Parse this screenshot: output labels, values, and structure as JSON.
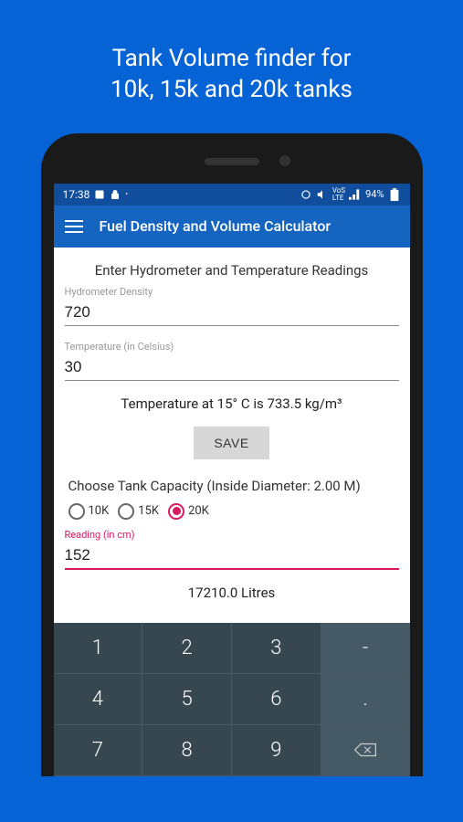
{
  "promo": {
    "line1": "Tank Volume finder for",
    "line2": "10k, 15k and 20k tanks"
  },
  "status": {
    "time": "17:38",
    "battery": "94%"
  },
  "appbar": {
    "title": "Fuel Density and Volume Calculator"
  },
  "section1": {
    "title": "Enter Hydrometer and Temperature Readings",
    "density_label": "Hydrometer Density",
    "density_value": "720",
    "temp_label": "Temperature (in Celsius)",
    "temp_value": "30",
    "result": "Temperature at 15° C is 733.5 kg/m³",
    "save": "SAVE"
  },
  "section2": {
    "title": "Choose Tank Capacity (Inside Diameter: 2.00 M)",
    "options": {
      "o1": "10K",
      "o2": "15K",
      "o3": "20K"
    },
    "reading_label": "Reading (in cm)",
    "reading_value": "152",
    "result": "17210.0 Litres"
  },
  "keyboard": {
    "k1": "1",
    "k2": "2",
    "k3": "3",
    "kdash": "-",
    "k4": "4",
    "k5": "5",
    "k6": "6",
    "kdot": ".",
    "k7": "7",
    "k8": "8",
    "k9": "9"
  }
}
